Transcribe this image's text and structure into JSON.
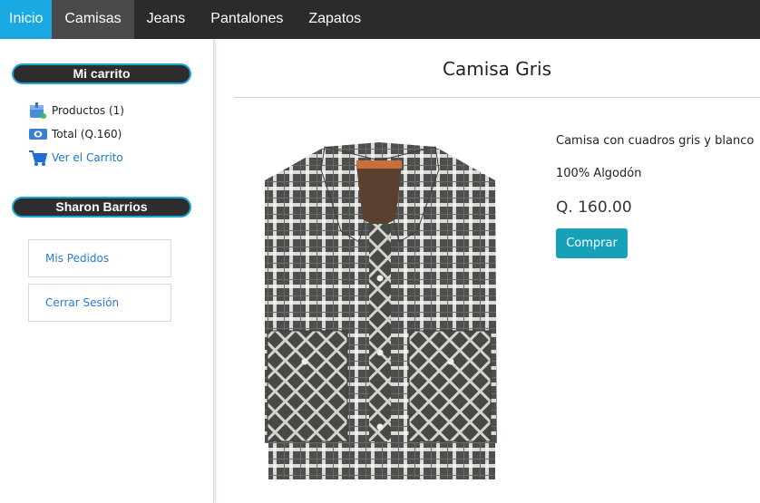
{
  "nav": {
    "items": [
      {
        "label": "Inicio"
      },
      {
        "label": "Camisas"
      },
      {
        "label": "Jeans"
      },
      {
        "label": "Pantalones"
      },
      {
        "label": "Zapatos"
      }
    ],
    "active_index": 1,
    "colors": {
      "bar": "#2b2b2b",
      "home": "#1aa9e3",
      "active": "#4a4a4a"
    }
  },
  "sidebar": {
    "cart": {
      "heading": "Mi carrito",
      "products": "Productos (1)",
      "total": "Total (Q.160)",
      "view_cart": "Ver el Carrito"
    },
    "user": {
      "name": "Sharon Barrios",
      "menu": [
        {
          "label": "Mis Pedidos",
          "icon": "none"
        },
        {
          "label": "Cerrar Sesión",
          "icon": "none"
        }
      ]
    },
    "accent": "#17a8d6"
  },
  "product": {
    "title": "Camisa Gris",
    "description": "Camisa con cuadros gris y blanco",
    "material": "100% Algodón",
    "price": "Q. 160.00",
    "buy_label": "Comprar",
    "image": "shirt-plaid-gray-photo",
    "button_color": "#17a1b8"
  }
}
